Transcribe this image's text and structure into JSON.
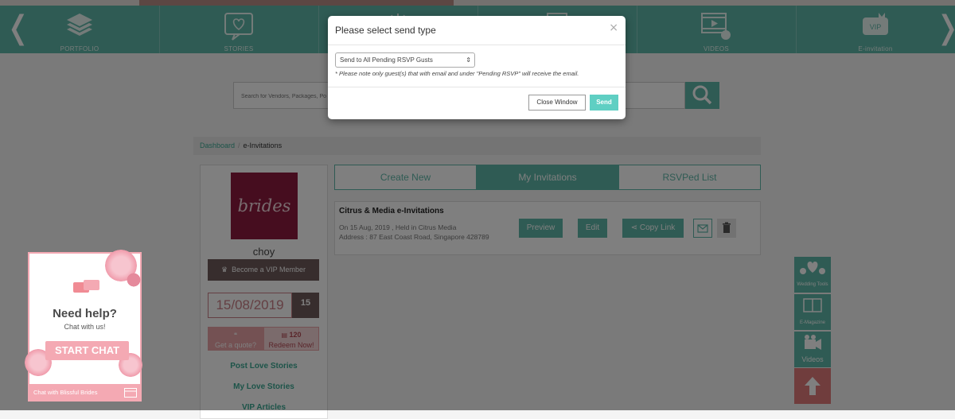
{
  "nav": {
    "items": [
      {
        "label": "PORTFOLIO",
        "icon": "layers-icon"
      },
      {
        "label": "STORIES",
        "icon": "hearts-chat-icon"
      },
      {
        "label": "",
        "icon": "sparkle-icon"
      },
      {
        "label": "",
        "icon": "screen-icon"
      },
      {
        "label": "VIDEOS",
        "icon": "video-touch-icon"
      },
      {
        "label": "E-invitation",
        "icon": "vip-icon"
      }
    ],
    "vip_icon_text": "VIP",
    "left_arrow": "❬",
    "right_arrow": "❭"
  },
  "search": {
    "placeholder": "Search for Vendors, Packages, Po"
  },
  "breadcrumb": {
    "home": "Dashboard",
    "separator": "/",
    "current": "e-Invitations"
  },
  "profile": {
    "logo_text": "brides",
    "username": "choy",
    "vip_label": "Become a VIP Member",
    "date": "15/08/2019",
    "days": "15",
    "quote_label": "Get a quote?",
    "redeem_points": "120",
    "redeem_label": "Redeem Now!",
    "links": [
      "Post Love Stories",
      "My Love Stories",
      "VIP Articles"
    ]
  },
  "tabs": [
    {
      "label": "Create New",
      "active": false
    },
    {
      "label": "My Invitations",
      "active": true
    },
    {
      "label": "RSVPed List",
      "active": false
    }
  ],
  "invitation": {
    "title": "Citrus & Media e-Invitations",
    "when": "On 15 Aug, 2019 , Held in Citrus Media",
    "address": "Address : 87 East Coast Road, Singapore 428789",
    "preview_label": "Preview",
    "edit_label": "Edit",
    "copy_label": "Copy Link"
  },
  "tools": [
    {
      "label": "Wedding Tools",
      "icon": "birds-heart-icon"
    },
    {
      "label": "E-Magazine",
      "icon": "book-icon"
    },
    {
      "label": "Videos",
      "icon": "camera-icon"
    },
    {
      "label": "",
      "icon": "arrow-up-icon"
    }
  ],
  "chat": {
    "title": "Need help?",
    "subtitle": "Chat with us!",
    "start_label": "START CHAT",
    "footer": "Chat with Blissful Brides"
  },
  "modal": {
    "title": "Please select send type",
    "close_glyph": "×",
    "select_value": "Send to All Pending RSVP Gusts",
    "note": "* Please note only guest(s) that with email and under \"Pending RSVP\" will receive the email.",
    "close_window_label": "Close Window",
    "send_label": "Send"
  },
  "colors": {
    "teal": "#5fb7a8",
    "send_button": "#5fcfc3",
    "pink": "#f4a9b3",
    "brides_logo_bg": "#8c1b3e",
    "brown": "#6e5a5a",
    "tool_up_bg": "#e07b7b"
  }
}
